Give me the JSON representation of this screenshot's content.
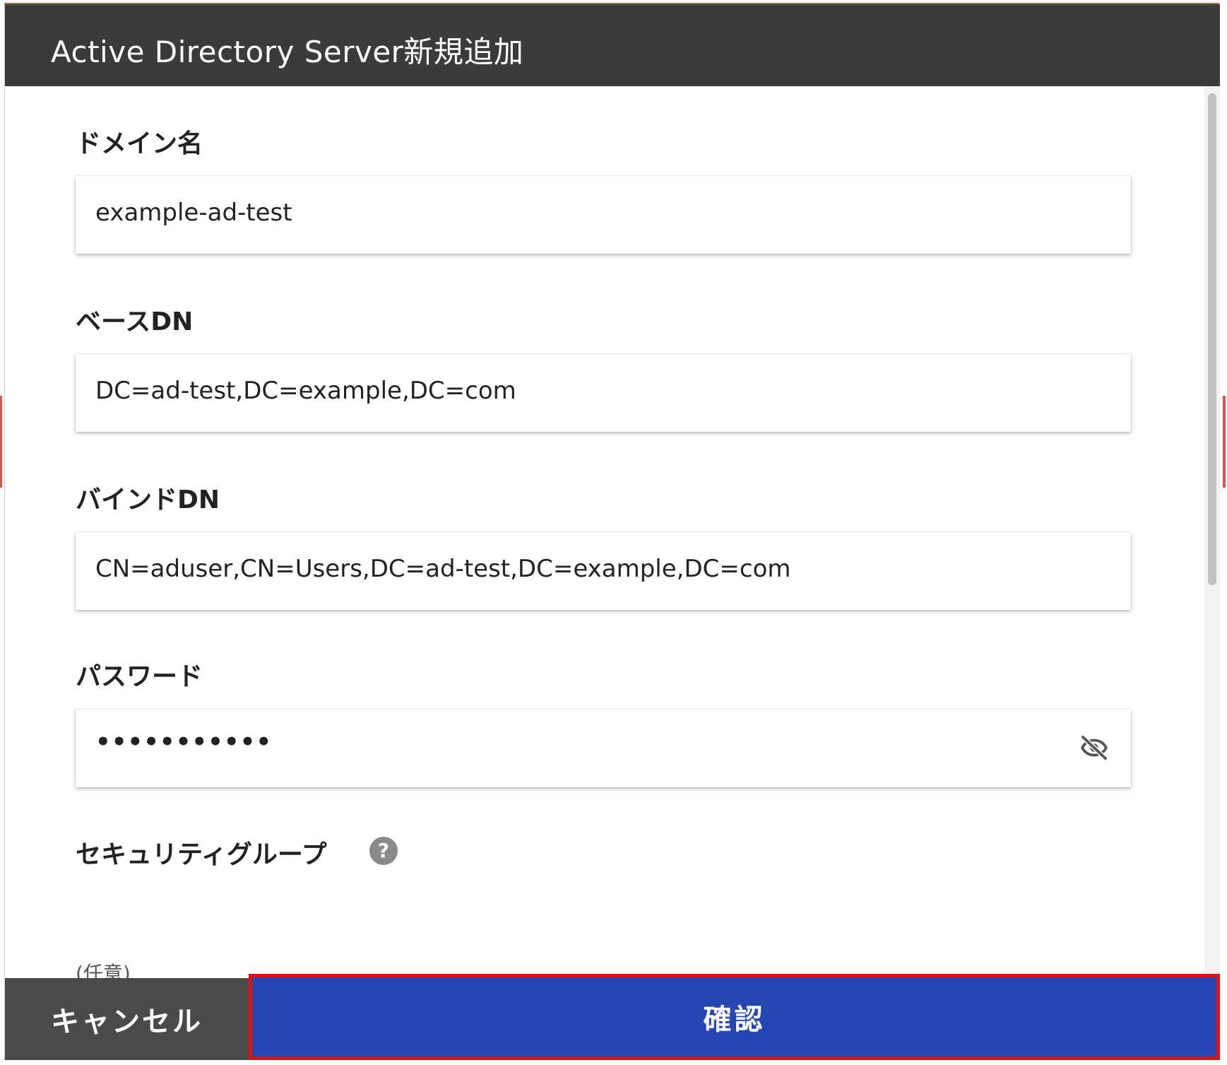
{
  "dialog": {
    "title": "Active Directory Server新規追加"
  },
  "fields": {
    "domain": {
      "label": "ドメイン名",
      "value": "example-ad-test"
    },
    "base_dn": {
      "label": "ベースDN",
      "value": "DC=ad-test,DC=example,DC=com"
    },
    "bind_dn": {
      "label": "バインドDN",
      "value": "CN=aduser,CN=Users,DC=ad-test,DC=example,DC=com"
    },
    "password": {
      "label": "パスワード",
      "masked_value": "•••••••••••",
      "visibility_icon": "eye-off-icon"
    },
    "security_group": {
      "label": "セキュリティグループ",
      "optional_note": "(任意)",
      "help_icon_glyph": "?"
    }
  },
  "footer": {
    "cancel_label": "キャンセル",
    "confirm_label": "確認"
  },
  "colors": {
    "titlebar": "#3b3b3b",
    "cancel": "#4a4a4a",
    "confirm": "#2547b4",
    "highlight_border": "#e01010"
  }
}
